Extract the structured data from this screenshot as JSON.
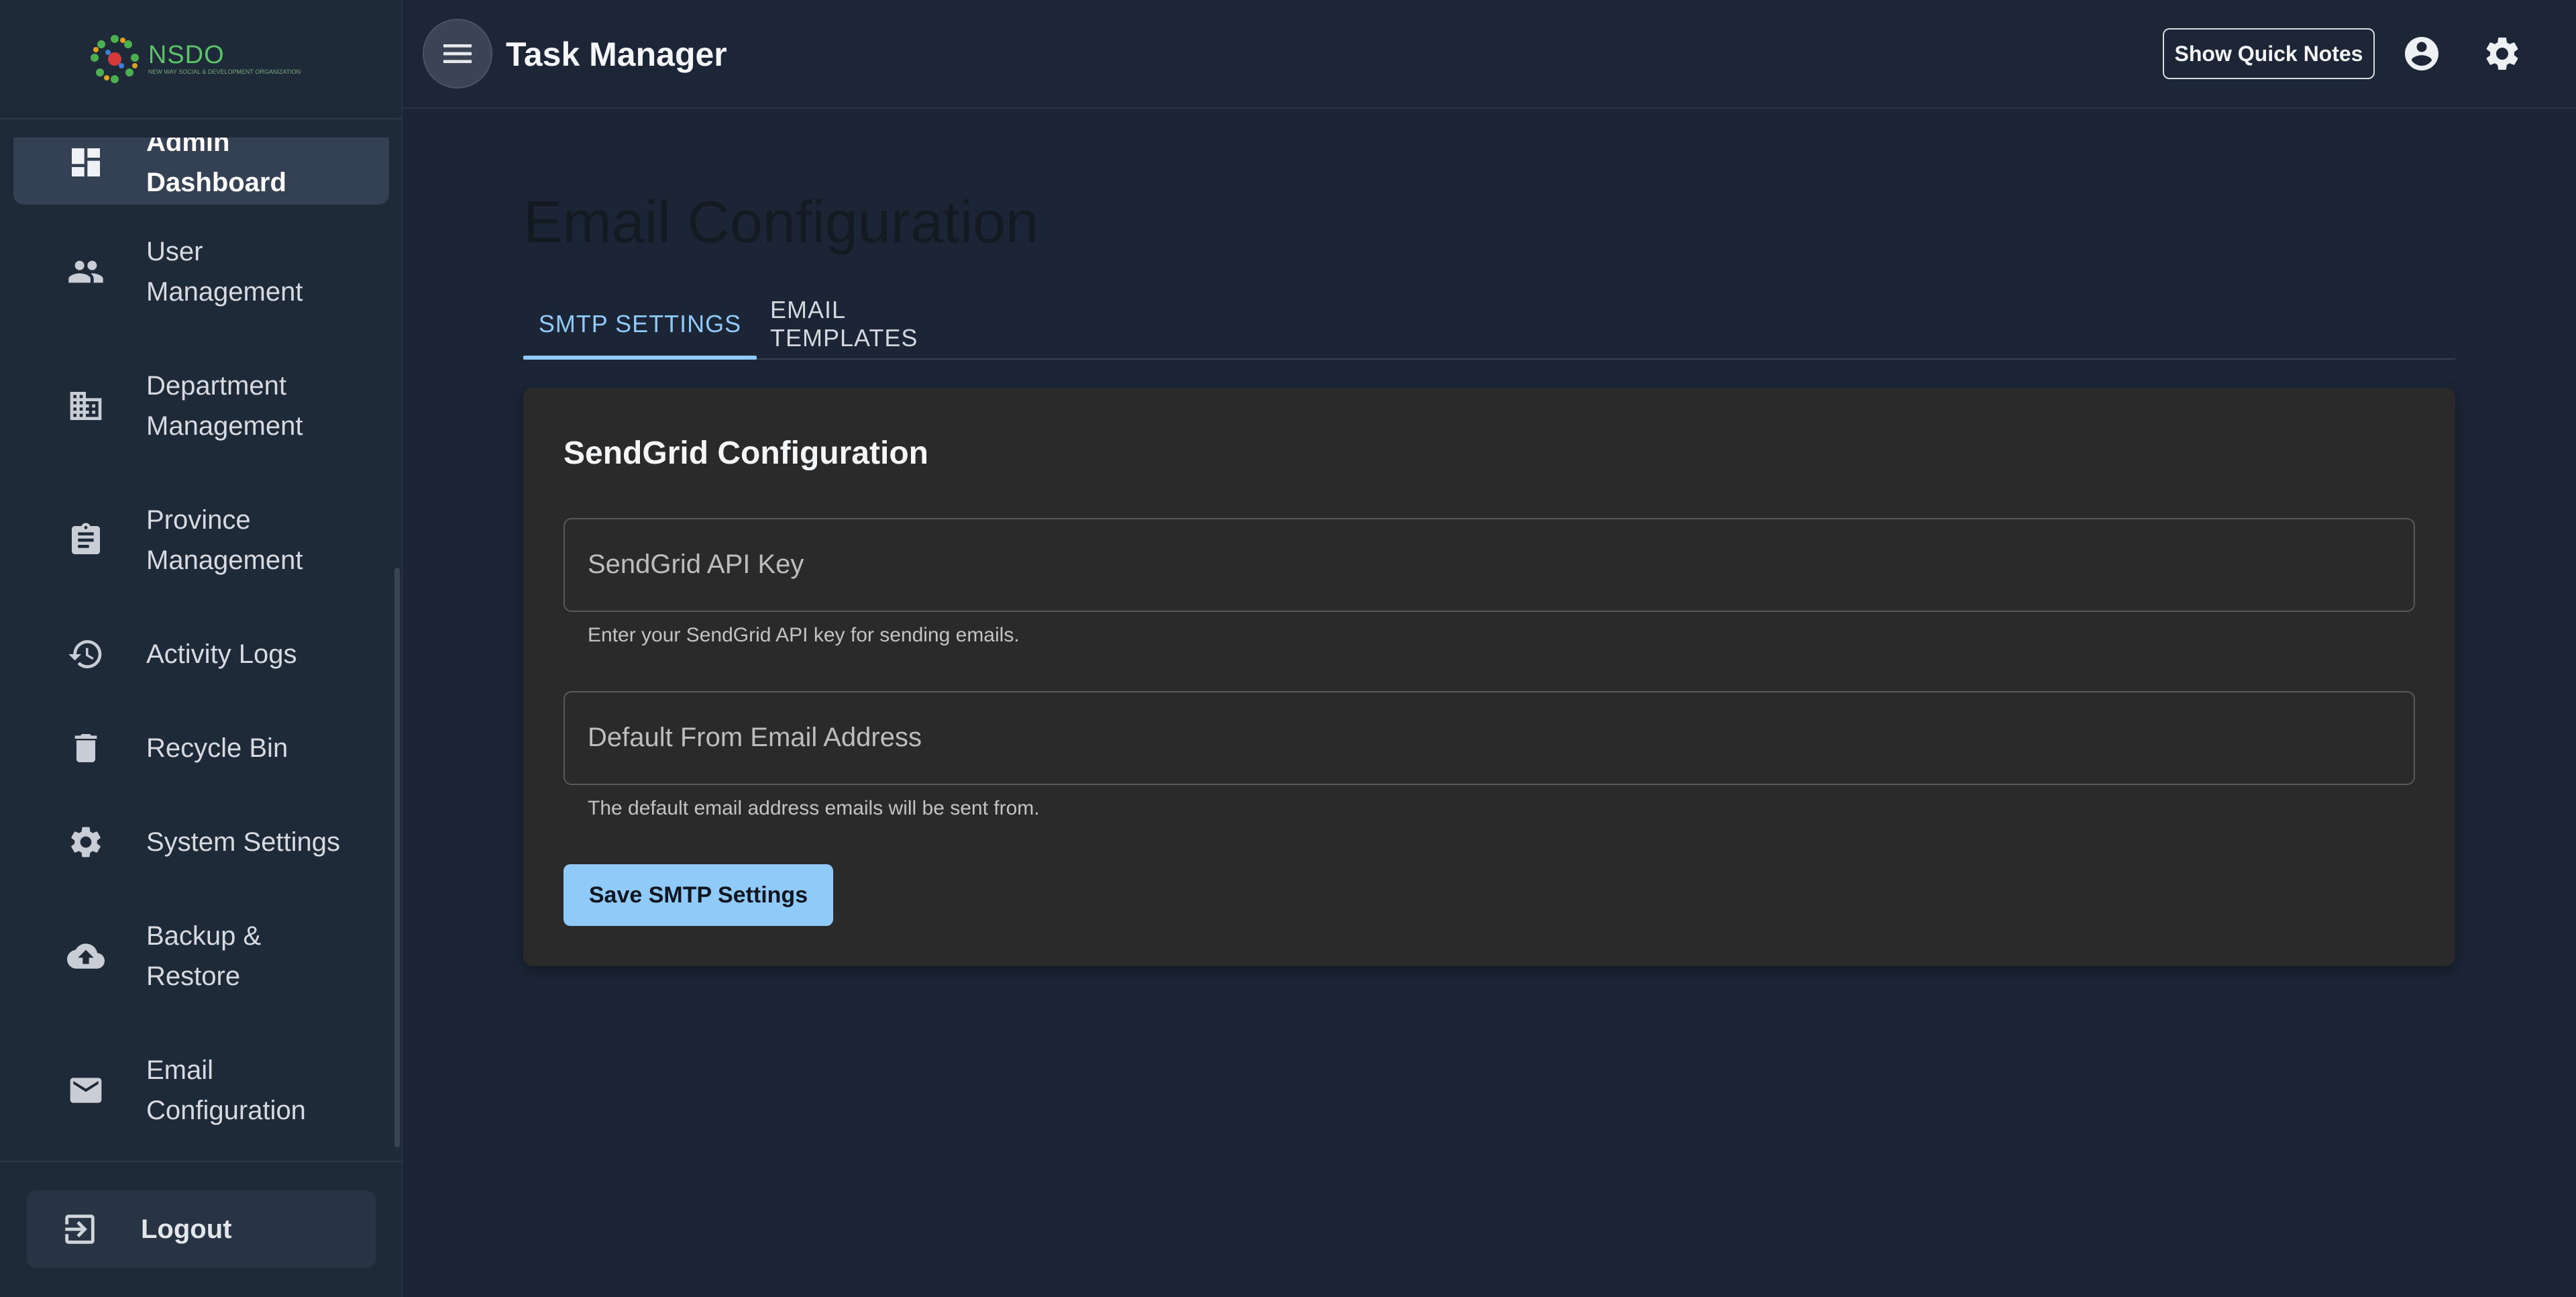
{
  "app": {
    "title": "Task Manager"
  },
  "logo": {
    "brand": "NSDO",
    "tagline": "NEW WAY SOCIAL & DEVELOPMENT ORGANIZATION"
  },
  "sidebar": {
    "items": [
      {
        "label": "Admin Dashboard",
        "icon": "dashboard-icon",
        "active": true
      },
      {
        "label": "User Management",
        "icon": "people-icon"
      },
      {
        "label": "Department Management",
        "icon": "building-icon"
      },
      {
        "label": "Province Management",
        "icon": "clipboard-icon"
      },
      {
        "label": "Activity Logs",
        "icon": "history-icon"
      },
      {
        "label": "Recycle Bin",
        "icon": "trash-icon"
      },
      {
        "label": "System Settings",
        "icon": "gear-icon"
      },
      {
        "label": "Backup & Restore",
        "icon": "cloud-upload-icon"
      },
      {
        "label": "Email Configuration",
        "icon": "mail-icon"
      }
    ],
    "logout_label": "Logout"
  },
  "topbar": {
    "quick_notes_label": "Show Quick Notes"
  },
  "page": {
    "title": "Email Configuration",
    "tabs": [
      {
        "label": "SMTP SETTINGS",
        "selected": true
      },
      {
        "label": "EMAIL TEMPLATES",
        "selected": false
      }
    ]
  },
  "card": {
    "title": "SendGrid Configuration",
    "api_key": {
      "placeholder": "SendGrid API Key",
      "value": "",
      "helper": "Enter your SendGrid API key for sending emails."
    },
    "from_email": {
      "placeholder": "Default From Email Address",
      "value": "",
      "helper": "The default email address emails will be sent from."
    },
    "save_label": "Save SMTP Settings"
  },
  "colors": {
    "accent": "#90caf9",
    "sidebar_bg": "#1f2a38",
    "main_bg": "#1b2535",
    "card_bg": "#2a2a2a"
  }
}
